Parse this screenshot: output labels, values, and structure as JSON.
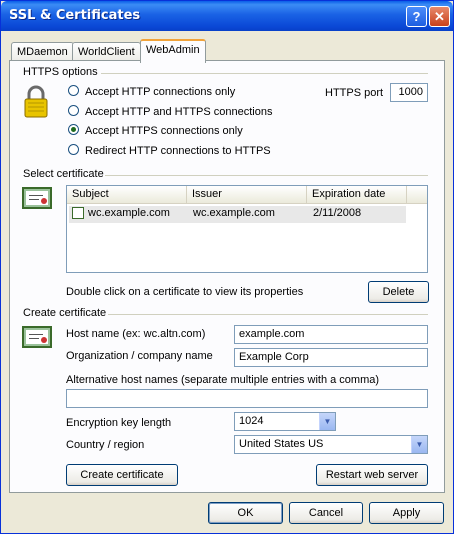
{
  "window": {
    "title": "SSL & Certificates",
    "help_glyph": "?",
    "close_glyph": "✕"
  },
  "tabs": [
    {
      "label": "MDaemon",
      "active": false
    },
    {
      "label": "WorldClient",
      "active": false
    },
    {
      "label": "WebAdmin",
      "active": true
    }
  ],
  "https_options": {
    "group_label": "HTTPS options",
    "radios": [
      {
        "label": "Accept HTTP connections only",
        "checked": false
      },
      {
        "label": "Accept HTTP and HTTPS connections",
        "checked": false
      },
      {
        "label": "Accept HTTPS connections only",
        "checked": true
      },
      {
        "label": "Redirect HTTP connections to HTTPS",
        "checked": false
      }
    ],
    "port_label": "HTTPS port",
    "port_value": "1000"
  },
  "select_certificate": {
    "group_label": "Select certificate",
    "columns": [
      "Subject",
      "Issuer",
      "Expiration date"
    ],
    "rows": [
      {
        "subject": "wc.example.com",
        "issuer": "wc.example.com",
        "expiration": "2/11/2008"
      }
    ],
    "hint": "Double click on a certificate to view its properties",
    "delete_label": "Delete"
  },
  "create_certificate": {
    "group_label": "Create certificate",
    "host_label": "Host name (ex: wc.altn.com)",
    "host_value": "example.com",
    "org_label": "Organization / company name",
    "org_value": "Example Corp",
    "alt_label": "Alternative host names (separate multiple entries with a comma)",
    "alt_value": "",
    "key_label": "Encryption key length",
    "key_value": "1024",
    "country_label": "Country / region",
    "country_value": "United States US",
    "create_label": "Create certificate",
    "restart_label": "Restart web server"
  },
  "footer": {
    "ok_label": "OK",
    "cancel_label": "Cancel",
    "apply_label": "Apply"
  }
}
